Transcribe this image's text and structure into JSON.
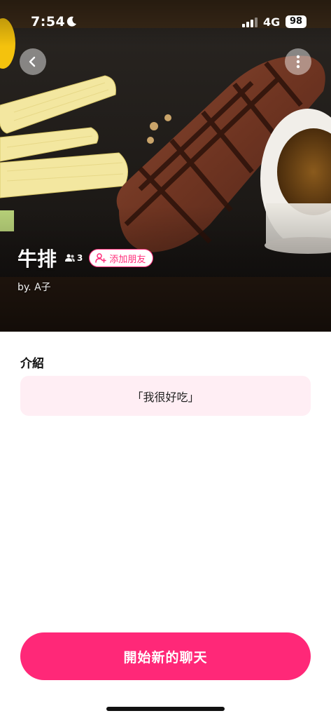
{
  "status_bar": {
    "time": "7:54",
    "network": "4G",
    "battery": "98"
  },
  "hero": {
    "name": "牛排",
    "member_count": "3",
    "add_friend_label": "添加朋友",
    "author": "by. A子"
  },
  "intro": {
    "title": "介紹",
    "text": "「我很好吃」"
  },
  "actions": {
    "start_chat_label": "開始新的聊天"
  },
  "colors": {
    "accent": "#ff2878",
    "intro_bg": "#ffeef4"
  }
}
